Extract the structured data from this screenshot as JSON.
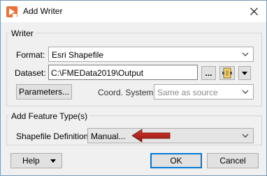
{
  "window": {
    "title": "Add Writer",
    "icon": "fme-writer-icon"
  },
  "writer_group": {
    "title": "Writer",
    "format_label": "Format:",
    "format_value": "Esri Shapefile",
    "dataset_label": "Dataset:",
    "dataset_value": "C:\\FMEData2019\\Output",
    "browse_label": "...",
    "parameters_label": "Parameters...",
    "coord_label": "Coord. System:",
    "coord_value": "Same as source"
  },
  "feature_group": {
    "title": "Add Feature Type(s)",
    "definition_label": "Shapefile Definition:",
    "definition_value": "Manual..."
  },
  "footer": {
    "help_label": "Help",
    "ok_label": "OK",
    "cancel_label": "Cancel"
  },
  "colors": {
    "arrow": "#b22222",
    "accent": "#0078d7"
  }
}
